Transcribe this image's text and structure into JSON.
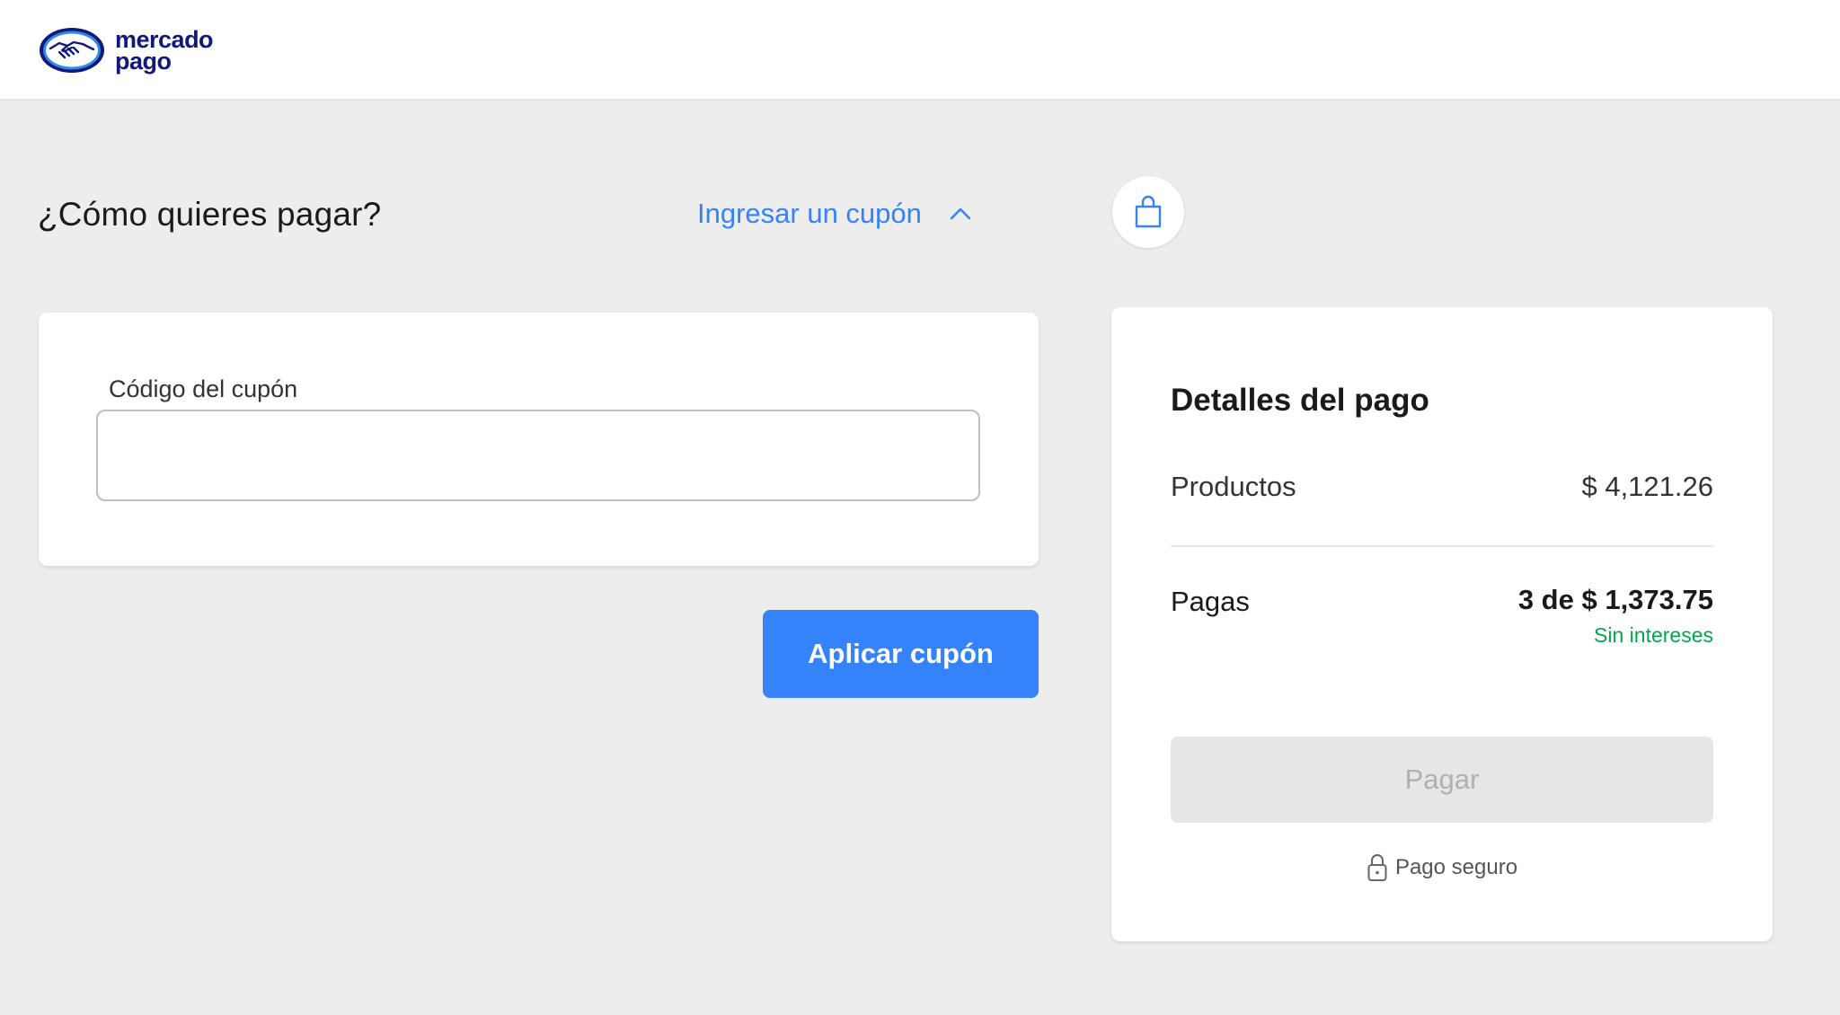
{
  "header": {
    "logo": {
      "line1": "mercado",
      "line2": "pago",
      "icon": "handshake-logo-icon",
      "brand_color": "#11187a",
      "accent_color": "#2f8be6"
    }
  },
  "main": {
    "title": "¿Cómo quieres pagar?",
    "coupon_toggle": {
      "label": "Ingresar un cupón",
      "icon": "chevron-up-icon",
      "expanded": true
    },
    "coupon_form": {
      "label": "Código del cupón",
      "value": "",
      "placeholder": ""
    },
    "apply_button": "Aplicar cupón"
  },
  "summary": {
    "bag_icon": "shopping-bag-icon",
    "title": "Detalles del pago",
    "products_label": "Productos",
    "products_value": "$ 4,121.26",
    "pagas_label": "Pagas",
    "installments_prefix": "3 de",
    "installments_amount": "$ 1,373.75",
    "interest_note": "Sin intereses",
    "pay_button": "Pagar",
    "pay_enabled": false,
    "secure_label": "Pago seguro",
    "secure_icon": "lock-icon"
  },
  "colors": {
    "primary": "#3483fa",
    "success": "#00a650",
    "background": "#ededed",
    "disabled_bg": "#e6e6e6",
    "disabled_text": "#b0b0b0"
  }
}
